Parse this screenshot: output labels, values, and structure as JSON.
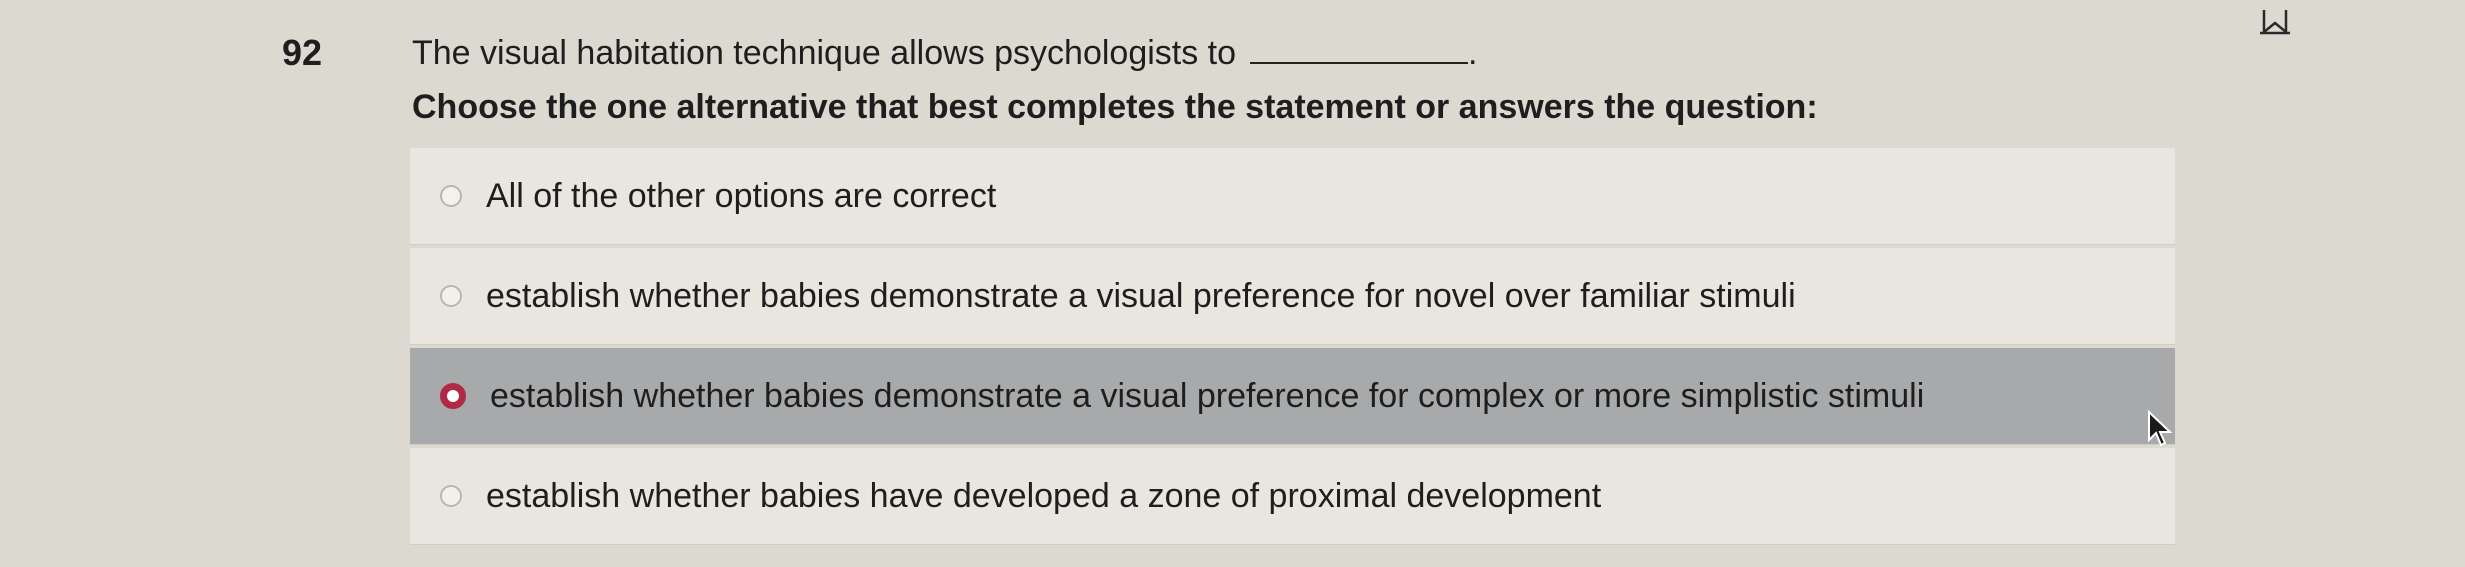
{
  "question": {
    "number": "92",
    "stem": "The visual habitation technique allows psychologists to",
    "stem_end": ".",
    "instruction": "Choose the one alternative that best completes the statement or answers the question:"
  },
  "options": [
    {
      "label": "All of the other options are correct",
      "selected": false
    },
    {
      "label": "establish whether babies demonstrate a visual preference for novel over familiar stimuli",
      "selected": false
    },
    {
      "label": "establish whether babies demonstrate a visual preference for complex or more simplistic stimuli",
      "selected": true
    },
    {
      "label": "establish whether babies have developed a zone of proximal development",
      "selected": false
    }
  ],
  "icons": {
    "bookmark": "bookmark-flag-icon",
    "cursor": "mouse-pointer-icon"
  },
  "colors": {
    "background": "#dcd9d1",
    "option_background": "#e9e6df",
    "selected_background": "#a7a9ab",
    "radio_selected": "#b02a48"
  }
}
